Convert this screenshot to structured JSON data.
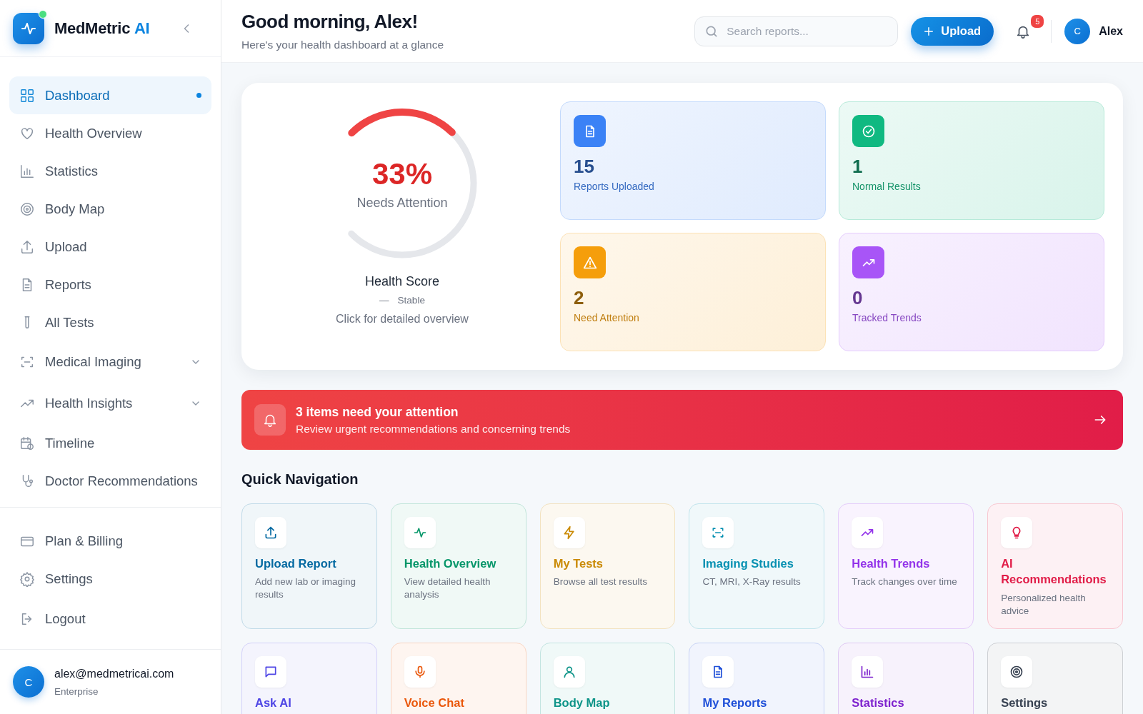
{
  "brand": {
    "name": "MedMetric",
    "accent": "AI",
    "online": true
  },
  "sidebar": {
    "items": [
      {
        "label": "Dashboard",
        "selected": true
      },
      {
        "label": "Health Overview",
        "selected": false
      },
      {
        "label": "Statistics",
        "selected": false
      },
      {
        "label": "Body Map",
        "selected": false
      },
      {
        "label": "Upload",
        "selected": false
      },
      {
        "label": "Reports",
        "selected": false
      },
      {
        "label": "All Tests",
        "selected": false
      },
      {
        "label": "Medical Imaging",
        "selected": false,
        "expanded": false
      },
      {
        "label": "Health Insights",
        "selected": false,
        "expanded": false
      },
      {
        "label": "Timeline",
        "selected": false
      },
      {
        "label": "Doctor Recommendations",
        "selected": false
      }
    ],
    "footer_items": [
      {
        "label": "Plan & Billing"
      },
      {
        "label": "Settings"
      },
      {
        "label": "Logout"
      }
    ],
    "user": {
      "initial": "C",
      "email": "alex@medmetricai.com",
      "plan": "Enterprise"
    }
  },
  "header": {
    "greeting": "Good morning, Alex!",
    "subtitle": "Here's your health dashboard at a glance",
    "search": {
      "placeholder": "Search reports..."
    },
    "upload_button": "Upload",
    "notifications": "5",
    "user": {
      "initial": "C",
      "name": "Alex"
    }
  },
  "score": {
    "value": "33%",
    "status": "Needs Attention",
    "level": 0.33,
    "title": "Health Score",
    "trend_mark": "—",
    "trend": "Stable",
    "hint": "Click for detailed overview"
  },
  "stats": [
    {
      "value": "15",
      "label": "Reports Uploaded",
      "color": "#3b82f6"
    },
    {
      "value": "1",
      "label": "Normal Results",
      "color": "#10b981"
    },
    {
      "value": "2",
      "label": "Need Attention",
      "color": "#f59e0b"
    },
    {
      "value": "0",
      "label": "Tracked Trends",
      "color": "#a855f7"
    }
  ],
  "alert": {
    "title": "3 items need your attention",
    "text": "Review urgent recommendations and concerning trends"
  },
  "quick_navigation": {
    "title": "Quick Navigation",
    "tiles": [
      {
        "title": "Upload Report",
        "description": "Add new lab or imaging results",
        "color": "#0369a1"
      },
      {
        "title": "Health Overview",
        "description": "View detailed health analysis",
        "color": "#059669"
      },
      {
        "title": "My Tests",
        "description": "Browse all test results",
        "color": "#ca8a04"
      },
      {
        "title": "Imaging Studies",
        "description": "CT, MRI, X-Ray results",
        "color": "#0891b2"
      },
      {
        "title": "Health Trends",
        "description": "Track changes over time",
        "color": "#9333ea"
      },
      {
        "title": "AI Recommendations",
        "description": "Personalized health advice",
        "color": "#e11d48"
      },
      {
        "title": "Ask AI",
        "color": "#4f46e5"
      },
      {
        "title": "Voice Chat",
        "color": "#ea580c"
      },
      {
        "title": "Body Map",
        "color": "#0d9488"
      },
      {
        "title": "My Reports",
        "color": "#1d4ed8"
      },
      {
        "title": "Statistics",
        "color": "#7e22ce"
      },
      {
        "title": "Settings",
        "color": "#374151"
      }
    ]
  }
}
